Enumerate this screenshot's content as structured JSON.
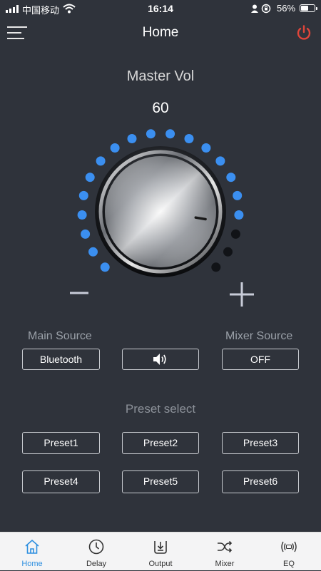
{
  "status_bar": {
    "carrier": "中国移动",
    "time": "16:14",
    "battery": "56%",
    "battery_level": 0.56
  },
  "header": {
    "title": "Home",
    "menu_icon": "menu-icon",
    "power_icon": "power-icon",
    "power_color": "#e0453a"
  },
  "master_volume": {
    "label": "Master Vol",
    "value": "60",
    "level_dots_total": 20,
    "level_dots_lit": 17,
    "lit_color": "#3b8ff0",
    "unlit_color": "#111317"
  },
  "sources": {
    "main_label": "Main Source",
    "main_value": "Bluetooth",
    "speaker_icon": "speaker-icon",
    "mixer_label": "Mixer Source",
    "mixer_value": "OFF"
  },
  "presets": {
    "title": "Preset select",
    "items": [
      "Preset1",
      "Preset2",
      "Preset3",
      "Preset4",
      "Preset5",
      "Preset6"
    ]
  },
  "tabs": [
    {
      "label": "Home",
      "icon": "home-icon",
      "active": true
    },
    {
      "label": "Delay",
      "icon": "clock-icon",
      "active": false
    },
    {
      "label": "Output",
      "icon": "output-icon",
      "active": false
    },
    {
      "label": "Mixer",
      "icon": "shuffle-icon",
      "active": false
    },
    {
      "label": "EQ",
      "icon": "eq-icon",
      "active": false
    }
  ],
  "colors": {
    "background": "#2f333b",
    "accent": "#2e8fe0"
  }
}
